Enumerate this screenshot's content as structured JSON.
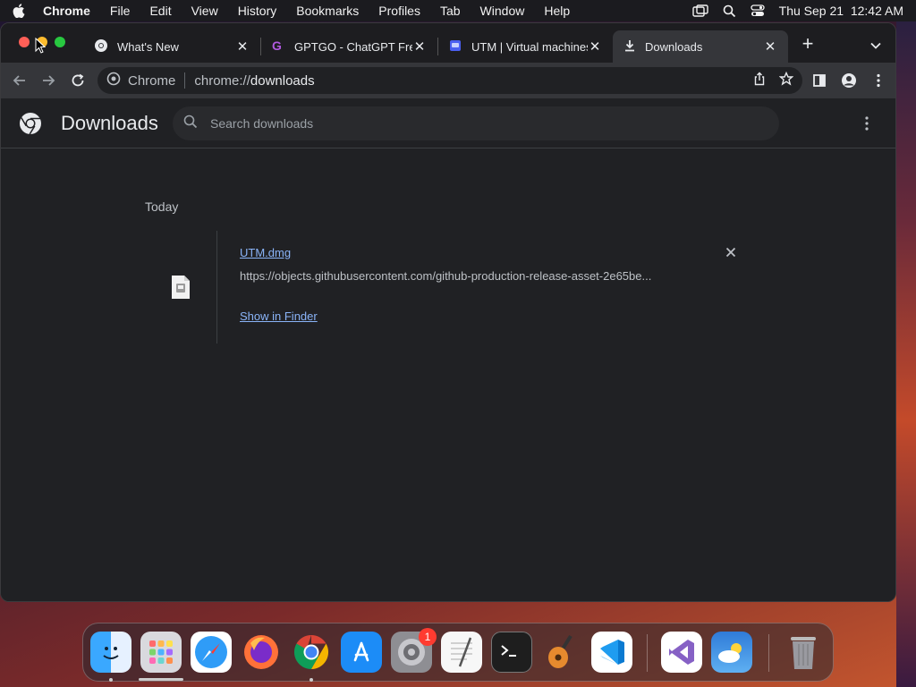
{
  "menubar": {
    "app_name": "Chrome",
    "items": [
      "File",
      "Edit",
      "View",
      "History",
      "Bookmarks",
      "Profiles",
      "Tab",
      "Window",
      "Help"
    ],
    "datetime": "Thu Sep 21  12:42 AM"
  },
  "tabs": [
    {
      "title": "What's New",
      "icon": "chrome-icon"
    },
    {
      "title": "GPTGO - ChatGPT Free",
      "icon": "gptgo-icon"
    },
    {
      "title": "UTM | Virtual machines",
      "icon": "utm-icon"
    },
    {
      "title": "Downloads",
      "icon": "download-icon",
      "active": true
    }
  ],
  "omnibox": {
    "site_chip": "Chrome",
    "url_scheme": "chrome://",
    "url_path": "downloads"
  },
  "page": {
    "title": "Downloads",
    "search_placeholder": "Search downloads",
    "date_group": "Today",
    "downloads": [
      {
        "name": "UTM.dmg",
        "url": "https://objects.githubusercontent.com/github-production-release-asset-2e65be...",
        "action": "Show in Finder"
      }
    ]
  },
  "dock": {
    "apps": [
      "Finder",
      "Launchpad",
      "Safari",
      "Firefox",
      "Google Chrome",
      "App Store",
      "System Settings",
      "TextEdit",
      "Terminal",
      "GarageBand",
      "Visual Studio Code",
      "Visual Studio",
      "Weather",
      "Trash"
    ],
    "system_settings_badge": "1"
  },
  "colors": {
    "window_bg": "#202124",
    "toolbar_bg": "#35363a",
    "link": "#8ab4f8",
    "text": "#e8eaed"
  }
}
